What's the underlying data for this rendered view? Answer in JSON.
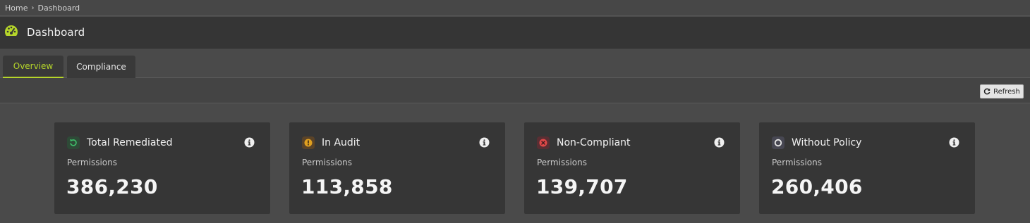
{
  "breadcrumb": {
    "items": [
      "Home",
      "Dashboard"
    ]
  },
  "header": {
    "title": "Dashboard",
    "icon": "gauge-icon",
    "icon_color": "#b5d52a"
  },
  "tabs": [
    {
      "label": "Overview",
      "active": true
    },
    {
      "label": "Compliance",
      "active": false
    }
  ],
  "toolbar": {
    "refresh_label": "Refresh"
  },
  "accent_color": "#b5d52a",
  "cards": [
    {
      "title": "Total Remediated",
      "subtitle": "Permissions",
      "value": "386,230",
      "icon": "remediate-icon",
      "icon_color": "#3fbf6a"
    },
    {
      "title": "In Audit",
      "subtitle": "Permissions",
      "value": "113,858",
      "icon": "warning-icon",
      "icon_color": "#e0a020"
    },
    {
      "title": "Non-Compliant",
      "subtitle": "Permissions",
      "value": "139,707",
      "icon": "error-icon",
      "icon_color": "#e04848"
    },
    {
      "title": "Without Policy",
      "subtitle": "Permissions",
      "value": "260,406",
      "icon": "ring-icon",
      "icon_color": "#e8e8e8"
    }
  ]
}
